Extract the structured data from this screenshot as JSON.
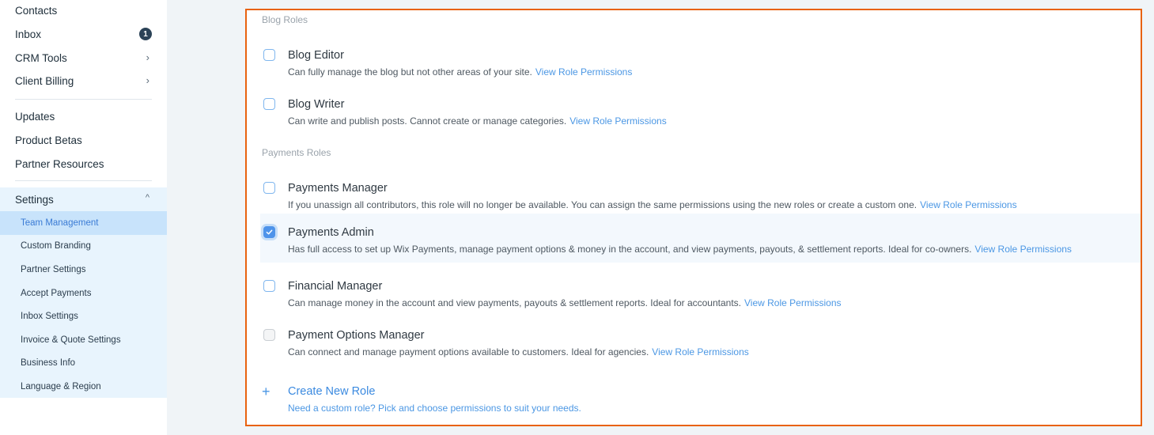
{
  "sidebar": {
    "items": [
      {
        "label": "Contacts"
      },
      {
        "label": "Inbox",
        "badge": "1"
      },
      {
        "label": "CRM Tools",
        "chevron": "›"
      },
      {
        "label": "Client Billing",
        "chevron": "›"
      },
      {
        "label": "Updates"
      },
      {
        "label": "Product Betas"
      },
      {
        "label": "Partner Resources"
      }
    ],
    "settings": {
      "label": "Settings",
      "chevron": "^",
      "expanded": true,
      "sub_items": [
        {
          "label": "Team Management",
          "active": true
        },
        {
          "label": "Custom Branding"
        },
        {
          "label": "Partner Settings"
        },
        {
          "label": "Accept Payments"
        },
        {
          "label": "Inbox Settings"
        },
        {
          "label": "Invoice & Quote Settings"
        },
        {
          "label": "Business Info"
        },
        {
          "label": "Language & Region"
        }
      ]
    }
  },
  "roles": {
    "link_label": "View Role Permissions",
    "sections": [
      {
        "label": "Blog Roles",
        "roles": [
          {
            "title": "Blog Editor",
            "desc": "Can fully manage the blog but not other areas of your site.",
            "checked": false
          },
          {
            "title": "Blog Writer",
            "desc": "Can write and publish posts. Cannot create or manage categories.",
            "checked": false
          }
        ]
      },
      {
        "label": "Payments Roles",
        "roles": [
          {
            "title": "Payments Manager",
            "desc": "If you unassign all contributors, this role will no longer be available. You can assign the same permissions using the new roles or create a custom one.",
            "checked": false
          },
          {
            "title": "Payments Admin",
            "desc": "Has full access to set up Wix Payments, manage payment options & money in the account, and view payments, payouts, & settlement reports. Ideal for co-owners.",
            "checked": true
          },
          {
            "title": "Financial Manager",
            "desc": "Can manage money in the account and view payments, payouts & settlement reports. Ideal for accountants.",
            "checked": false
          },
          {
            "title": "Payment Options Manager",
            "desc": "Can connect and manage payment options available to customers. Ideal for agencies.",
            "checked": false,
            "disabled": true
          }
        ]
      }
    ],
    "create": {
      "icon": "+",
      "title": "Create New Role",
      "subtitle": "Need a custom role? Pick and choose permissions to suit your needs."
    }
  },
  "colors": {
    "accent": "#3b8ae0",
    "highlight_border": "#e8620f",
    "active_nav_bg": "#c8e3fb",
    "settings_bg": "#e8f4fd",
    "badge_bg": "#2b4257"
  }
}
